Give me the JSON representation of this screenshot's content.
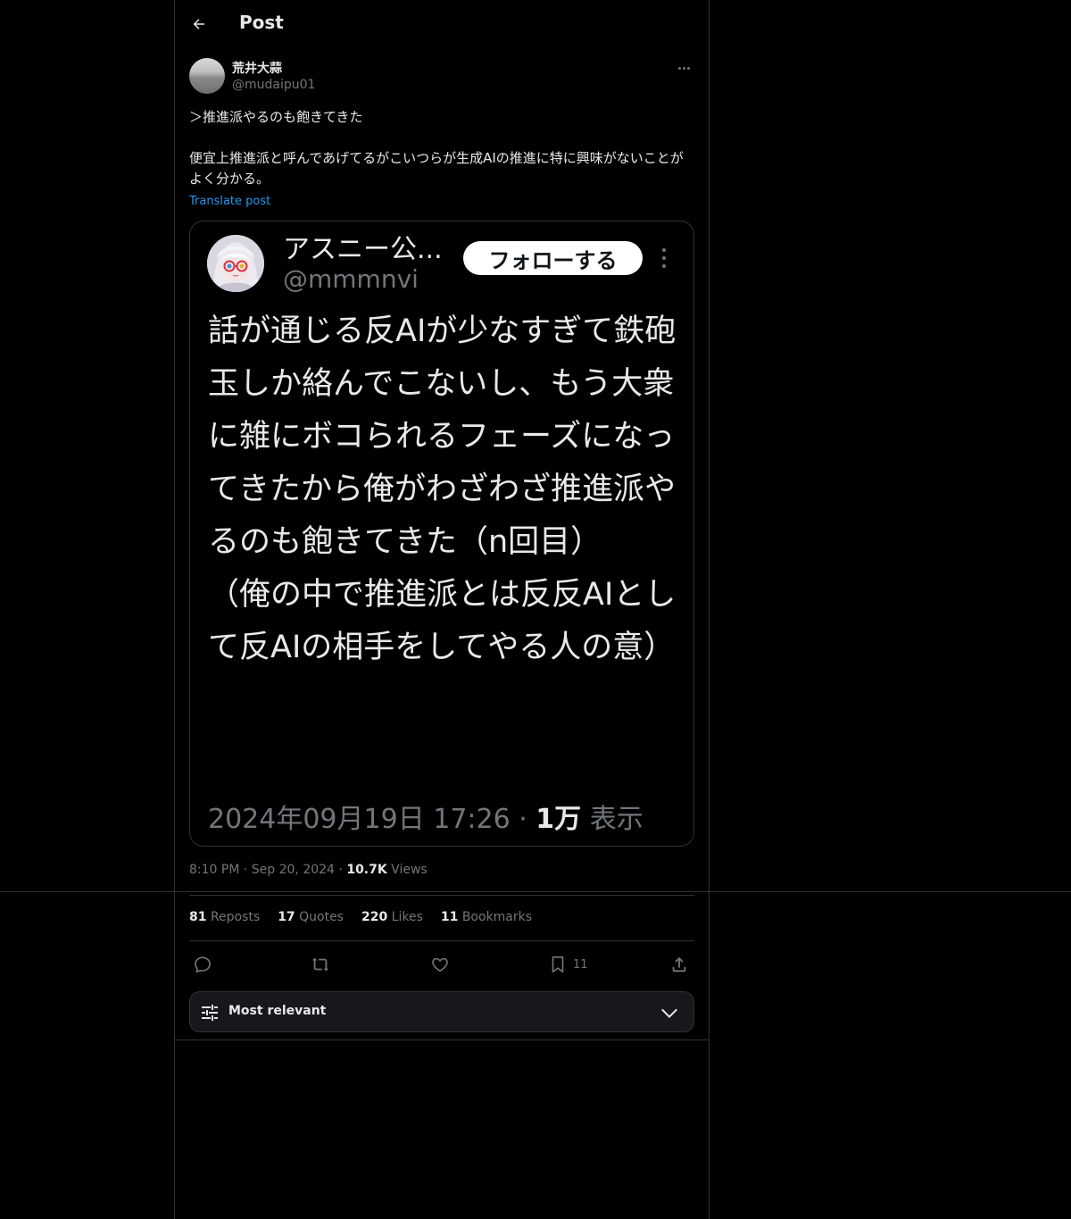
{
  "header": {
    "title": "Post"
  },
  "post": {
    "author_name": "荒井大蒜",
    "author_handle": "@mudaipu01",
    "text": "＞推進派やるのも飽きてきた\n\n便宜上推進派と呼んであげてるがこいつらが生成AIの推進に特に興味がないことがよく分かる。",
    "translate_label": "Translate post",
    "time": "8:10 PM",
    "date": "Sep 20, 2024",
    "views_count": "10.7K",
    "views_label": "Views"
  },
  "quote": {
    "name": "アスニー公...",
    "handle": "@mmmnvi",
    "follow_label": "フォローする",
    "text": "話が通じる反AIが少なすぎて鉄砲玉しか絡んでこないし、もう大衆に雑にボコられるフェーズになってきたから俺がわざわざ推進派やるのも飽きてきた（n回目）\n（俺の中で推進派とは反反AIとして反AIの相手をしてやる人の意）",
    "timestamp": "2024年09月19日 17:26",
    "views_count": "1万",
    "views_label": "表示"
  },
  "stats": {
    "reposts_count": "81",
    "reposts_label": "Reposts",
    "quotes_count": "17",
    "quotes_label": "Quotes",
    "likes_count": "220",
    "likes_label": "Likes",
    "bookmarks_count": "11",
    "bookmarks_label": "Bookmarks"
  },
  "actions": {
    "reply_icon": "reply-icon",
    "repost_icon": "repost-icon",
    "like_icon": "heart-icon",
    "bookmark_icon": "bookmark-icon",
    "bookmark_count": "11",
    "share_icon": "share-icon"
  },
  "sort": {
    "label": "Most relevant"
  },
  "colors": {
    "background": "#000000",
    "text": "#e7e9ea",
    "muted": "#71767b",
    "link": "#1d9bf0",
    "border": "#2f3336"
  }
}
